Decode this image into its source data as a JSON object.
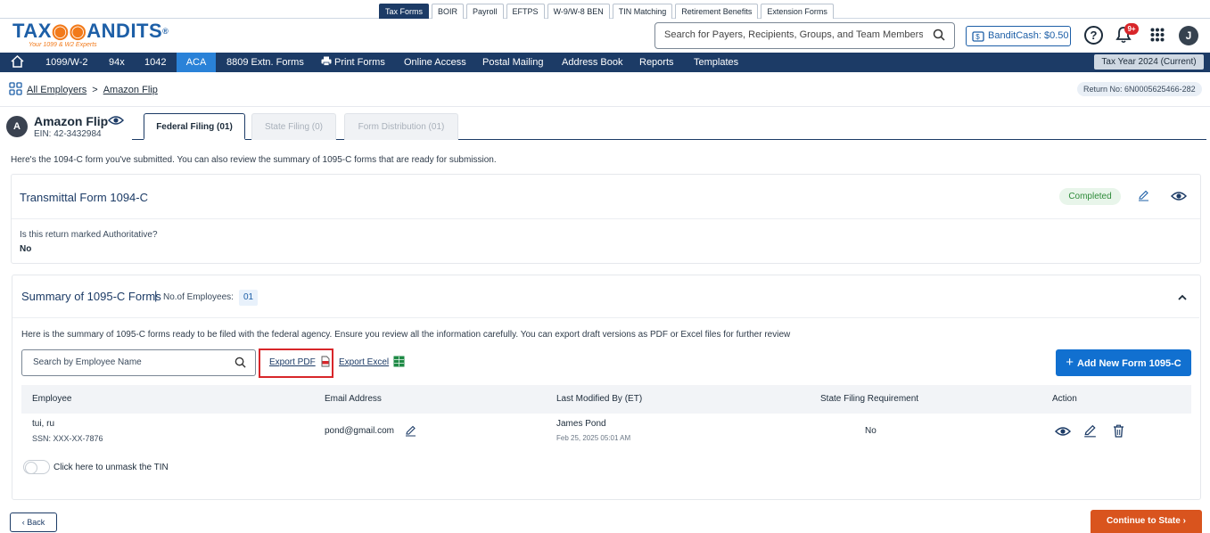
{
  "product_tabs": [
    "Tax Forms",
    "BOIR",
    "Payroll",
    "EFTPS",
    "W-9/W-8 BEN",
    "TIN Matching",
    "Retirement Benefits",
    "Extension Forms"
  ],
  "logo": {
    "text_a": "TAX",
    "text_b": "ANDITS",
    "reg": "®",
    "tagline": "Your 1099 & W2 Experts"
  },
  "header": {
    "search_placeholder": "Search for Payers, Recipients, Groups, and Team Members",
    "bandit_cash": "BanditCash: $0.50",
    "help": "?",
    "notif_badge": "9+",
    "user_initial": "J"
  },
  "nav": {
    "items": [
      "1099/W-2",
      "94x",
      "1042",
      "ACA",
      "8809 Extn. Forms",
      "Print Forms",
      "Online Access",
      "Postal Mailing",
      "Address Book",
      "Reports",
      "Templates"
    ],
    "active": "ACA",
    "tax_year": "Tax Year 2024 (Current)"
  },
  "breadcrumb": {
    "all": "All Employers",
    "sep": ">",
    "current": "Amazon Flip"
  },
  "return_no": "Return No: 6N0005625466-282",
  "employer": {
    "initial": "A",
    "name": "Amazon Flip",
    "ein": "EIN: 42-3432984"
  },
  "filing_tabs": [
    "Federal Filing (01)",
    "State Filing (0)",
    "Form Distribution (01)"
  ],
  "intro": "Here's the 1094-C form you've submitted. You can also review the summary of 1095-C forms that are ready for submission.",
  "transmittal": {
    "title": "Transmittal Form 1094-C",
    "status": "Completed",
    "question": "Is this return marked Authoritative?",
    "answer": "No"
  },
  "summary": {
    "title": "Summary of 1095-C Forms",
    "sep": "|",
    "count_label": "No.of Employees:",
    "count": "01",
    "description": "Here is the summary of 1095-C forms ready to be filed with the federal agency. Ensure you review all the information carefully. You can export draft versions as PDF or Excel files for further review",
    "search_placeholder": "Search by Employee Name",
    "export_pdf": "Export PDF",
    "export_excel": "Export Excel",
    "add_button": "Add New Form 1095-C",
    "add_plus": "+"
  },
  "table": {
    "headers": [
      "Employee",
      "Email Address",
      "Last Modified By (ET)",
      "State Filing Requirement",
      "Action"
    ],
    "rows": [
      {
        "name": "tui, ru",
        "ssn": "SSN: XXX-XX-7876",
        "email": "pond@gmail.com",
        "modified_by": "James Pond",
        "modified_at": "Feb 25, 2025 05:01 AM",
        "state_req": "No"
      }
    ]
  },
  "unmask_label": "Click here to unmask the TIN",
  "footer": {
    "back": "Back",
    "continue": "Continue to State"
  },
  "colors": {
    "navy": "#1c3b66",
    "active_nav": "#2a82d8",
    "accent_orange": "#d9541e",
    "primary_blue": "#1170d0",
    "highlight_red": "#d8262a",
    "success_green": "#2e8b3a"
  }
}
